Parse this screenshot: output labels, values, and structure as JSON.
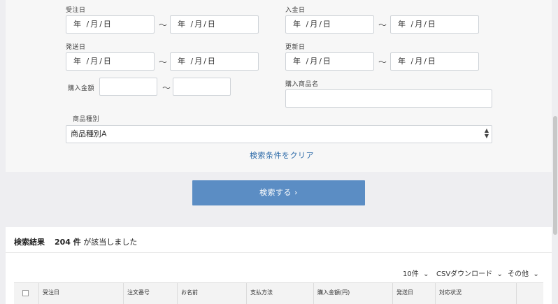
{
  "filters": {
    "order_date": {
      "label": "受注日",
      "from_placeholder": "年 /月/日",
      "to_placeholder": "年 /月/日"
    },
    "payment_date": {
      "label": "入金日",
      "from_placeholder": "年 /月/日",
      "to_placeholder": "年 /月/日"
    },
    "ship_date": {
      "label": "発送日",
      "from_placeholder": "年 /月/日",
      "to_placeholder": "年 /月/日"
    },
    "update_date": {
      "label": "更新日",
      "from_placeholder": "年 /月/日",
      "to_placeholder": "年 /月/日"
    },
    "purchase_amount": {
      "label": "購入金額",
      "from_value": "",
      "to_value": ""
    },
    "product_name": {
      "label": "購入商品名",
      "value": ""
    },
    "product_type": {
      "label": "商品種別",
      "selected": "商品種別A"
    },
    "range_separator": "〜",
    "clear_link": "検索条件をクリア"
  },
  "search_button": "検索する ›",
  "results": {
    "title": "検索結果",
    "count": "204 件",
    "count_suffix": "が該当しました",
    "per_page": "10件",
    "csv_download": "CSVダウンロード",
    "other": "その他",
    "columns": [
      "受注日",
      "注文番号",
      "お名前",
      "支払方法",
      "購入金額(円)",
      "発送日",
      "対応状況"
    ]
  }
}
